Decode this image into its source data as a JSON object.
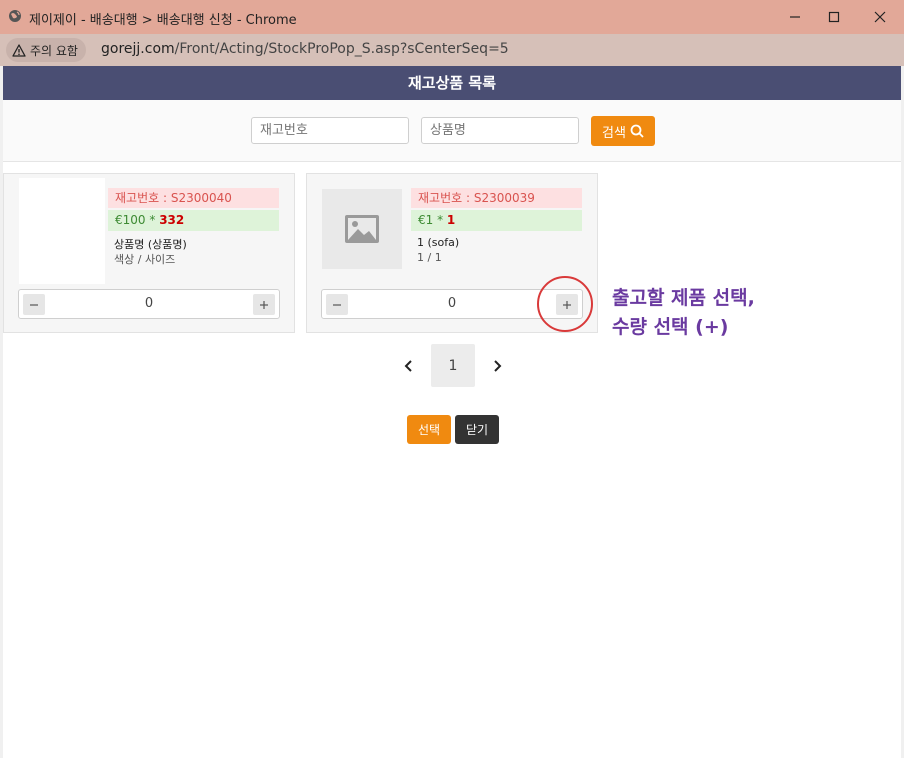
{
  "window": {
    "title": "제이제이 - 배송대행 > 배송대행 신청 - Chrome",
    "minimize_icon": "minimize-icon",
    "maximize_icon": "maximize-icon",
    "close_icon": "close-icon"
  },
  "address_bar": {
    "security_label": "주의 요함",
    "url_host": "gorejj.com",
    "url_path": "/Front/Acting/StockProPop_S.asp?sCenterSeq=5"
  },
  "page": {
    "heading": "재고상품 목록",
    "search": {
      "stock_no_placeholder": "재고번호",
      "product_name_placeholder": "상품명",
      "button_label": "검색"
    },
    "items": [
      {
        "code": "재고번호 : S2300040",
        "price": "€100",
        "times": " * ",
        "qty": "332",
        "name": "상품명 (상품명)",
        "option": "색상 / 사이즈",
        "count": "0",
        "has_image": false
      },
      {
        "code": "재고번호 : S2300039",
        "price": "€1",
        "times": " * ",
        "qty": "1",
        "name": "1 (sofa)",
        "option": "1 / 1",
        "count": "0",
        "has_image": false
      }
    ],
    "pagination": {
      "current": "1"
    },
    "buttons": {
      "select": "선택",
      "close": "닫기"
    }
  },
  "annotation": {
    "line1": "출고할 제품 선택,",
    "line2": "수량 선택 (+)",
    "color": "#6a3aa0",
    "circle_color": "#d93a3a"
  },
  "colors": {
    "header_bg": "#4a4e73",
    "accent_orange": "#f08a10",
    "titlebar_bg": "#e2a898"
  }
}
